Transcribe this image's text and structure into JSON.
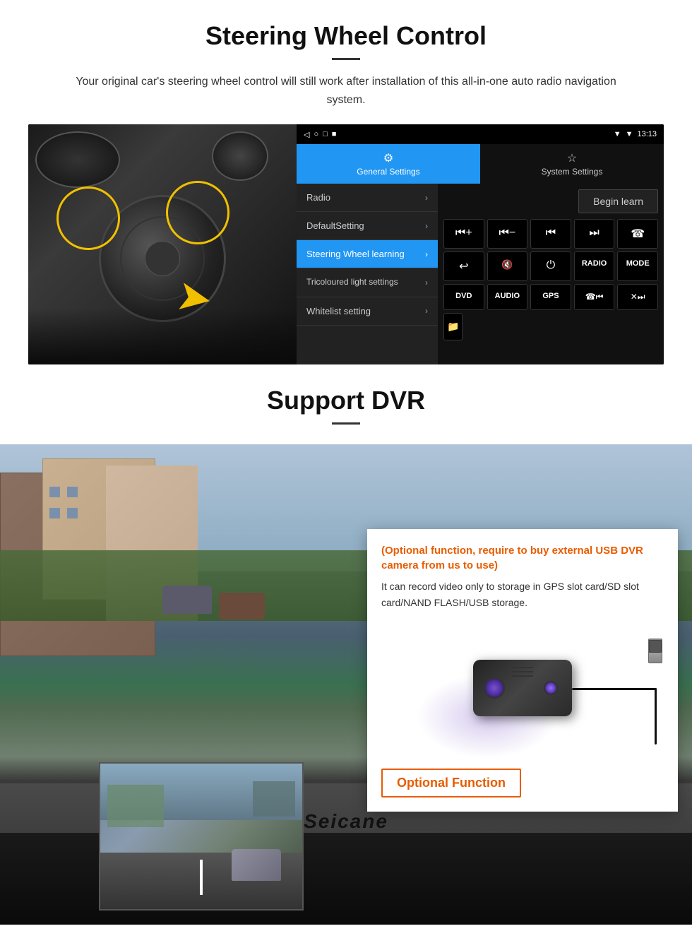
{
  "steering": {
    "title": "Steering Wheel Control",
    "subtitle": "Your original car's steering wheel control will still work after installation of this all-in-one auto radio navigation system.",
    "statusbar": {
      "time": "13:13",
      "signal": "▼",
      "wifi": "▼"
    },
    "nav_icons": [
      "◁",
      "○",
      "□",
      "■"
    ],
    "tabs": [
      {
        "label": "General Settings",
        "icon": "⚙",
        "active": true
      },
      {
        "label": "System Settings",
        "icon": "☆",
        "active": false
      }
    ],
    "menu_items": [
      {
        "label": "Radio",
        "active": false
      },
      {
        "label": "DefaultSetting",
        "active": false
      },
      {
        "label": "Steering Wheel learning",
        "active": true
      },
      {
        "label": "Tricoloured light settings",
        "active": false
      },
      {
        "label": "Whitelist setting",
        "active": false
      }
    ],
    "begin_learn": "Begin learn",
    "controls": [
      "⏮+",
      "⏮−",
      "⏮|",
      "⏭|",
      "☎",
      "↩",
      "🔇",
      "⏻",
      "RADIO",
      "MODE",
      "DVD",
      "AUDIO",
      "GPS",
      "☎⏮|",
      "✕⏭|"
    ]
  },
  "dvr": {
    "title": "Support DVR",
    "info_orange": "(Optional function, require to buy external USB DVR camera from us to use)",
    "info_text": "It can record video only to storage in GPS slot card/SD slot card/NAND FLASH/USB storage.",
    "optional_label": "Optional Function",
    "brand": "Seicane"
  }
}
